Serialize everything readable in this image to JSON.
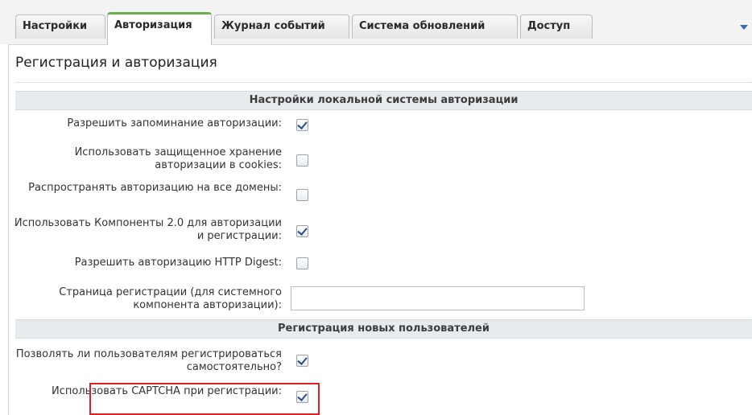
{
  "tabs": [
    {
      "label": "Настройки",
      "active": false
    },
    {
      "label": "Авторизация",
      "active": true
    },
    {
      "label": "Журнал событий",
      "active": false
    },
    {
      "label": "Система обновлений",
      "active": false
    },
    {
      "label": "Доступ",
      "active": false
    }
  ],
  "page": {
    "title": "Регистрация и авторизация"
  },
  "sections": {
    "local_auth": "Настройки локальной системы авторизации",
    "new_users": "Регистрация новых пользователей"
  },
  "fields": {
    "remember_auth": {
      "label": "Разрешить запоминание авторизации:",
      "checked": true
    },
    "secure_cookies": {
      "label": "Использовать защищенное хранение авторизации в cookies:",
      "checked": false
    },
    "all_domains": {
      "label": "Распространять авторизацию на все домены:",
      "checked": false
    },
    "components_2": {
      "label": "Использовать Компоненты 2.0 для авторизации и регистрации:",
      "checked": true
    },
    "http_digest": {
      "label": "Разрешить авторизацию HTTP Digest:",
      "checked": false
    },
    "register_page": {
      "label": "Страница регистрации (для системного компонента авторизации):",
      "value": ""
    },
    "self_register": {
      "label": "Позволять ли пользователям регистрироваться самостоятельно?",
      "checked": true
    },
    "captcha": {
      "label": "Использовать CAPTCHA при регистрации:",
      "checked": true
    }
  },
  "colors": {
    "active_tab_accent": "#6fae4c",
    "highlight_border": "#e02020"
  }
}
